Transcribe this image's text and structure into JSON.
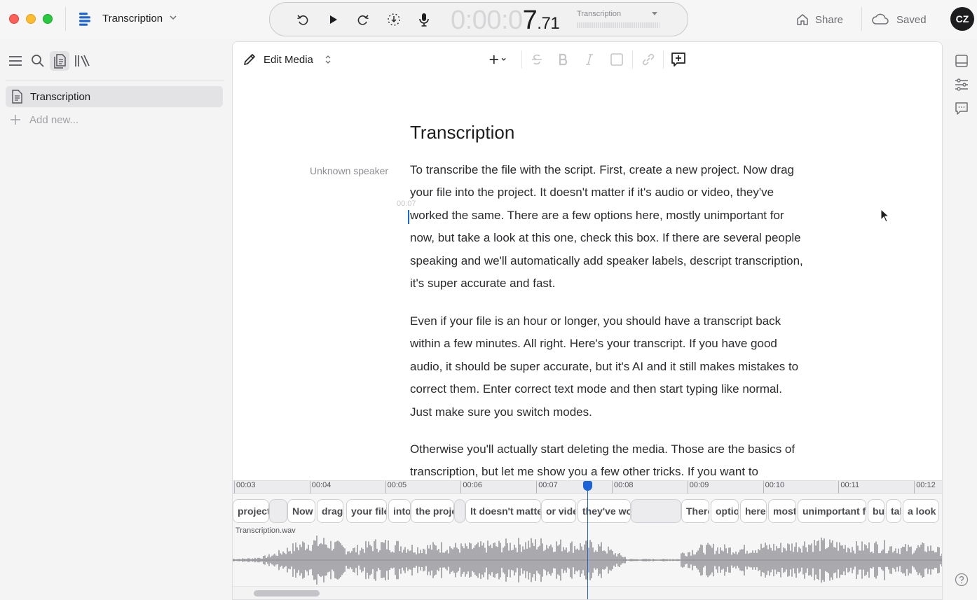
{
  "app": {
    "title": "Transcription"
  },
  "transport": {
    "timecode_dim": "0:00:0",
    "timecode_bright": "7",
    "timecode_fraction": ".71",
    "source_label": "Transcription"
  },
  "header": {
    "share_label": "Share",
    "saved_label": "Saved",
    "avatar_initials": "CZ"
  },
  "sidebar": {
    "items": [
      {
        "label": "Transcription",
        "icon": "document-icon",
        "selected": true
      }
    ],
    "add_label": "Add new..."
  },
  "editor": {
    "mode_label": "Edit Media",
    "doc_title": "Transcription",
    "speaker": "Unknown speaker",
    "time_marker": "00:07",
    "paragraphs": [
      "To transcribe the file with the script. First, create a new project. Now drag your file into the project. It doesn't matter if it's audio or video, they've worked the same. There are a few options here, mostly unimportant for now, but take a look at this one, check this box. If there are several people speaking and we'll automatically add speaker labels, descript transcription, it's super accurate and fast.",
      "Even if your file is an hour or longer, you should have a transcript back within a few minutes. All right. Here's your transcript. If you have good audio, it should be super accurate, but it's AI and it still makes mistakes to correct them. Enter correct text mode and then start typing like normal. Just make sure you switch modes.",
      "Otherwise you'll actually start deleting the media. Those are the basics of transcription, but let me show you a few other tricks. If you want to"
    ]
  },
  "timeline": {
    "ticks": [
      "00:03",
      "00:04",
      "00:05",
      "00:06",
      "00:07",
      "00:08",
      "00:09",
      "00:10",
      "00:11",
      "00:12"
    ],
    "words": [
      "project",
      "",
      "Now",
      "drag",
      "your file",
      "into",
      "the project",
      "",
      "It doesn't matter",
      "or video",
      "they've worked",
      "",
      "There",
      "options",
      "here",
      "mostly",
      "unimportant for",
      "but",
      "take",
      "a look"
    ],
    "track_label": "Transcription.wav"
  },
  "colors": {
    "accent": "#1a63d8",
    "close": "#fe5f57",
    "minimize": "#febc2e",
    "maximize": "#28c840"
  }
}
